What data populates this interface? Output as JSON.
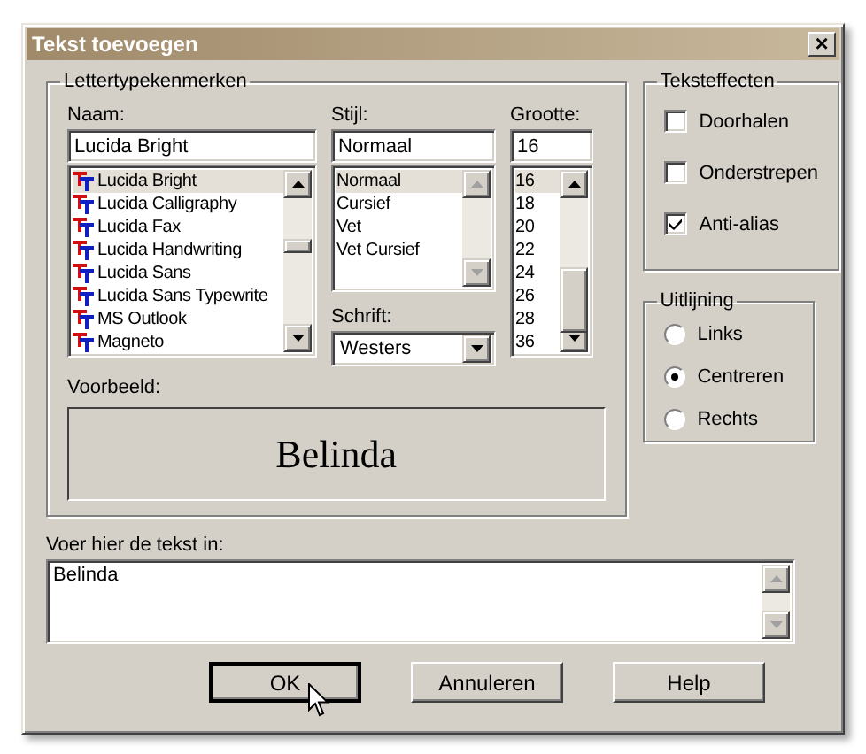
{
  "window": {
    "title": "Tekst toevoegen",
    "close": "×"
  },
  "font_group": {
    "title": "Lettertypekenmerken",
    "name": {
      "label": "Naam:",
      "value": "Lucida Bright",
      "items": [
        {
          "label": "Lucida Bright",
          "selected": true
        },
        {
          "label": "Lucida Calligraphy",
          "selected": false
        },
        {
          "label": "Lucida Fax",
          "selected": false
        },
        {
          "label": "Lucida Handwriting",
          "selected": false
        },
        {
          "label": "Lucida Sans",
          "selected": false
        },
        {
          "label": "Lucida Sans Typewrite",
          "selected": false
        },
        {
          "label": "MS Outlook",
          "selected": false
        },
        {
          "label": "Magneto",
          "selected": false
        }
      ]
    },
    "style": {
      "label": "Stijl:",
      "value": "Normaal",
      "items": [
        {
          "label": "Normaal",
          "selected": true
        },
        {
          "label": "Cursief",
          "selected": false
        },
        {
          "label": "Vet",
          "selected": false
        },
        {
          "label": "Vet Cursief",
          "selected": false
        }
      ]
    },
    "size": {
      "label": "Grootte:",
      "value": "16",
      "items": [
        {
          "label": "16",
          "selected": true
        },
        {
          "label": "18",
          "selected": false
        },
        {
          "label": "20",
          "selected": false
        },
        {
          "label": "22",
          "selected": false
        },
        {
          "label": "24",
          "selected": false
        },
        {
          "label": "26",
          "selected": false
        },
        {
          "label": "28",
          "selected": false
        },
        {
          "label": "36",
          "selected": false
        }
      ]
    },
    "script": {
      "label": "Schrift:",
      "value": "Westers"
    },
    "preview": {
      "label": "Voorbeeld:",
      "text": "Belinda"
    }
  },
  "effects": {
    "title": "Teksteffecten",
    "items": [
      {
        "label": "Doorhalen",
        "checked": false
      },
      {
        "label": "Onderstrepen",
        "checked": false
      },
      {
        "label": "Anti-alias",
        "checked": true
      }
    ]
  },
  "alignment": {
    "title": "Uitlijning",
    "items": [
      {
        "label": "Links",
        "selected": false
      },
      {
        "label": "Centreren",
        "selected": true
      },
      {
        "label": "Rechts",
        "selected": false
      }
    ]
  },
  "text_entry": {
    "label": "Voer hier de tekst in:",
    "value": "Belinda"
  },
  "buttons": [
    {
      "label": "OK",
      "default": true
    },
    {
      "label": "Annuleren",
      "default": false
    },
    {
      "label": "Help",
      "default": false
    }
  ]
}
